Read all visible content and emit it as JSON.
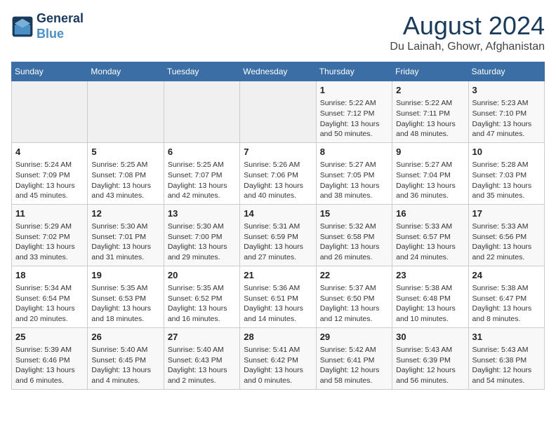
{
  "header": {
    "logo_line1": "General",
    "logo_line2": "Blue",
    "title": "August 2024",
    "subtitle": "Du Lainah, Ghowr, Afghanistan"
  },
  "weekdays": [
    "Sunday",
    "Monday",
    "Tuesday",
    "Wednesday",
    "Thursday",
    "Friday",
    "Saturday"
  ],
  "weeks": [
    [
      {
        "day": "",
        "info": ""
      },
      {
        "day": "",
        "info": ""
      },
      {
        "day": "",
        "info": ""
      },
      {
        "day": "",
        "info": ""
      },
      {
        "day": "1",
        "info": "Sunrise: 5:22 AM\nSunset: 7:12 PM\nDaylight: 13 hours\nand 50 minutes."
      },
      {
        "day": "2",
        "info": "Sunrise: 5:22 AM\nSunset: 7:11 PM\nDaylight: 13 hours\nand 48 minutes."
      },
      {
        "day": "3",
        "info": "Sunrise: 5:23 AM\nSunset: 7:10 PM\nDaylight: 13 hours\nand 47 minutes."
      }
    ],
    [
      {
        "day": "4",
        "info": "Sunrise: 5:24 AM\nSunset: 7:09 PM\nDaylight: 13 hours\nand 45 minutes."
      },
      {
        "day": "5",
        "info": "Sunrise: 5:25 AM\nSunset: 7:08 PM\nDaylight: 13 hours\nand 43 minutes."
      },
      {
        "day": "6",
        "info": "Sunrise: 5:25 AM\nSunset: 7:07 PM\nDaylight: 13 hours\nand 42 minutes."
      },
      {
        "day": "7",
        "info": "Sunrise: 5:26 AM\nSunset: 7:06 PM\nDaylight: 13 hours\nand 40 minutes."
      },
      {
        "day": "8",
        "info": "Sunrise: 5:27 AM\nSunset: 7:05 PM\nDaylight: 13 hours\nand 38 minutes."
      },
      {
        "day": "9",
        "info": "Sunrise: 5:27 AM\nSunset: 7:04 PM\nDaylight: 13 hours\nand 36 minutes."
      },
      {
        "day": "10",
        "info": "Sunrise: 5:28 AM\nSunset: 7:03 PM\nDaylight: 13 hours\nand 35 minutes."
      }
    ],
    [
      {
        "day": "11",
        "info": "Sunrise: 5:29 AM\nSunset: 7:02 PM\nDaylight: 13 hours\nand 33 minutes."
      },
      {
        "day": "12",
        "info": "Sunrise: 5:30 AM\nSunset: 7:01 PM\nDaylight: 13 hours\nand 31 minutes."
      },
      {
        "day": "13",
        "info": "Sunrise: 5:30 AM\nSunset: 7:00 PM\nDaylight: 13 hours\nand 29 minutes."
      },
      {
        "day": "14",
        "info": "Sunrise: 5:31 AM\nSunset: 6:59 PM\nDaylight: 13 hours\nand 27 minutes."
      },
      {
        "day": "15",
        "info": "Sunrise: 5:32 AM\nSunset: 6:58 PM\nDaylight: 13 hours\nand 26 minutes."
      },
      {
        "day": "16",
        "info": "Sunrise: 5:33 AM\nSunset: 6:57 PM\nDaylight: 13 hours\nand 24 minutes."
      },
      {
        "day": "17",
        "info": "Sunrise: 5:33 AM\nSunset: 6:56 PM\nDaylight: 13 hours\nand 22 minutes."
      }
    ],
    [
      {
        "day": "18",
        "info": "Sunrise: 5:34 AM\nSunset: 6:54 PM\nDaylight: 13 hours\nand 20 minutes."
      },
      {
        "day": "19",
        "info": "Sunrise: 5:35 AM\nSunset: 6:53 PM\nDaylight: 13 hours\nand 18 minutes."
      },
      {
        "day": "20",
        "info": "Sunrise: 5:35 AM\nSunset: 6:52 PM\nDaylight: 13 hours\nand 16 minutes."
      },
      {
        "day": "21",
        "info": "Sunrise: 5:36 AM\nSunset: 6:51 PM\nDaylight: 13 hours\nand 14 minutes."
      },
      {
        "day": "22",
        "info": "Sunrise: 5:37 AM\nSunset: 6:50 PM\nDaylight: 13 hours\nand 12 minutes."
      },
      {
        "day": "23",
        "info": "Sunrise: 5:38 AM\nSunset: 6:48 PM\nDaylight: 13 hours\nand 10 minutes."
      },
      {
        "day": "24",
        "info": "Sunrise: 5:38 AM\nSunset: 6:47 PM\nDaylight: 13 hours\nand 8 minutes."
      }
    ],
    [
      {
        "day": "25",
        "info": "Sunrise: 5:39 AM\nSunset: 6:46 PM\nDaylight: 13 hours\nand 6 minutes."
      },
      {
        "day": "26",
        "info": "Sunrise: 5:40 AM\nSunset: 6:45 PM\nDaylight: 13 hours\nand 4 minutes."
      },
      {
        "day": "27",
        "info": "Sunrise: 5:40 AM\nSunset: 6:43 PM\nDaylight: 13 hours\nand 2 minutes."
      },
      {
        "day": "28",
        "info": "Sunrise: 5:41 AM\nSunset: 6:42 PM\nDaylight: 13 hours\nand 0 minutes."
      },
      {
        "day": "29",
        "info": "Sunrise: 5:42 AM\nSunset: 6:41 PM\nDaylight: 12 hours\nand 58 minutes."
      },
      {
        "day": "30",
        "info": "Sunrise: 5:43 AM\nSunset: 6:39 PM\nDaylight: 12 hours\nand 56 minutes."
      },
      {
        "day": "31",
        "info": "Sunrise: 5:43 AM\nSunset: 6:38 PM\nDaylight: 12 hours\nand 54 minutes."
      }
    ]
  ]
}
